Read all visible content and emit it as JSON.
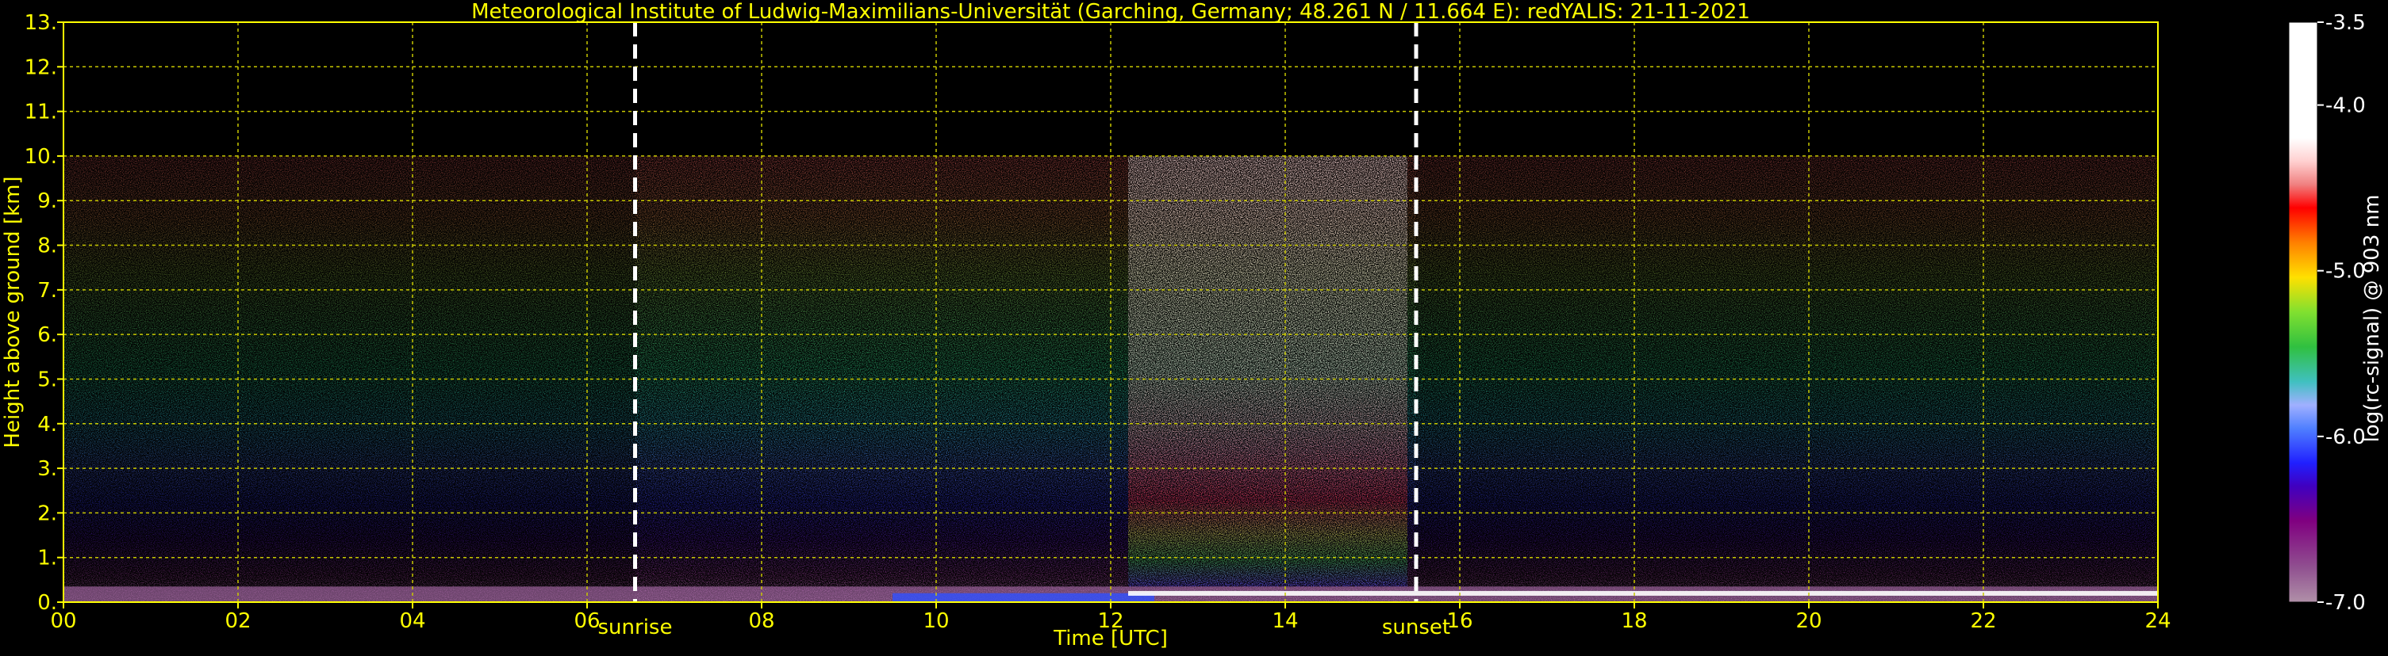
{
  "chart_data": {
    "type": "heatmap",
    "title": "Meteorological Institute of Ludwig-Maximilians-Universität (Garching, Germany; 48.261 N / 11.664 E):    redYALIS: 21-11-2021",
    "xlabel": "Time [UTC]",
    "ylabel": "Height above ground [km]",
    "xlim": [
      0,
      24
    ],
    "ylim": [
      0,
      13
    ],
    "x_tick_labels": [
      "00",
      "02",
      "04",
      "06",
      "08",
      "10",
      "12",
      "14",
      "16",
      "18",
      "20",
      "22",
      "24"
    ],
    "x_tick_values": [
      0,
      2,
      4,
      6,
      8,
      10,
      12,
      14,
      16,
      18,
      20,
      22,
      24
    ],
    "y_tick_labels": [
      "0.",
      "1.",
      "2.",
      "3.",
      "4.",
      "5.",
      "6.",
      "7.",
      "8.",
      "9.",
      "10.",
      "11.",
      "12.",
      "13."
    ],
    "y_tick_values": [
      0,
      1,
      2,
      3,
      4,
      5,
      6,
      7,
      8,
      9,
      10,
      11,
      12,
      13
    ],
    "grid": true,
    "data_top_km": 10,
    "events": [
      {
        "label": "sunrise",
        "time": 6.55
      },
      {
        "label": "sunset",
        "time": 15.5
      }
    ],
    "colorbar": {
      "label": "log(rc-signal) @ 903 nm",
      "range": [
        -7.0,
        -3.5
      ],
      "tick_labels": [
        "-3.5",
        "-4.0",
        "-5.0",
        "-6.0",
        "-7.0"
      ],
      "tick_values": [
        -3.5,
        -4.0,
        -5.0,
        -6.0,
        -7.0
      ]
    },
    "colors": {
      "axis": "#ffff00",
      "grid": "#c8c800",
      "event_line": "#ffffff",
      "text_white": "#ffffff"
    },
    "features": {
      "cloud_time_range": [
        12.2,
        15.4
      ],
      "cloud_base_km": 0.35,
      "boundary_layer_top_km": 0.35
    }
  }
}
